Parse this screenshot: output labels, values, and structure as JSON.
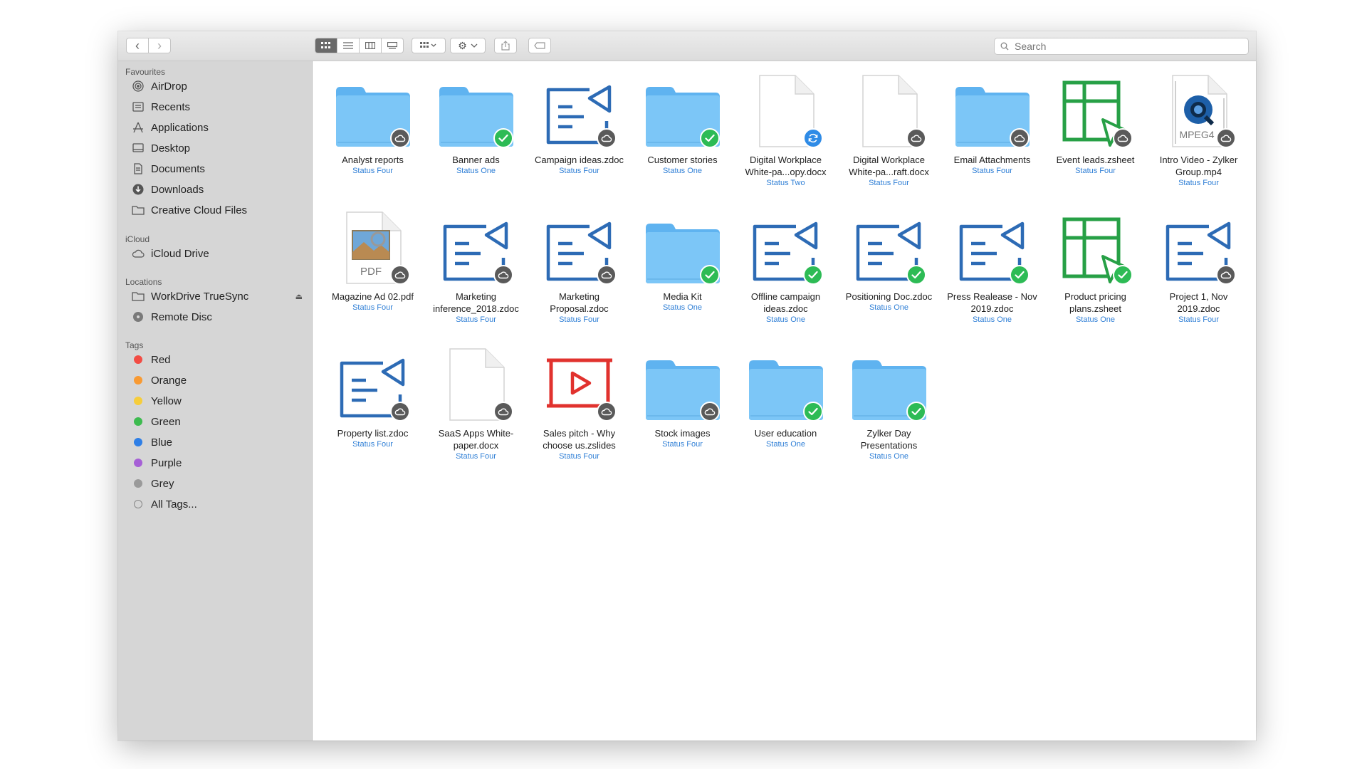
{
  "toolbar": {
    "back": "‹",
    "forward": "›",
    "search_placeholder": "Search"
  },
  "sidebar": {
    "favourites_title": "Favourites",
    "favourites": [
      {
        "label": "AirDrop",
        "icon": "airdrop-icon"
      },
      {
        "label": "Recents",
        "icon": "recents-icon"
      },
      {
        "label": "Applications",
        "icon": "applications-icon"
      },
      {
        "label": "Desktop",
        "icon": "desktop-icon"
      },
      {
        "label": "Documents",
        "icon": "documents-icon"
      },
      {
        "label": "Downloads",
        "icon": "downloads-icon"
      },
      {
        "label": "Creative Cloud Files",
        "icon": "folder-icon"
      }
    ],
    "icloud_title": "iCloud",
    "icloud": [
      {
        "label": "iCloud Drive",
        "icon": "cloud-icon"
      }
    ],
    "locations_title": "Locations",
    "locations": [
      {
        "label": "WorkDrive TrueSync",
        "icon": "drive-icon",
        "eject": "⏏"
      },
      {
        "label": "Remote Disc",
        "icon": "disc-icon"
      }
    ],
    "tags_title": "Tags",
    "tags": [
      {
        "label": "Red",
        "color": "#f24c44"
      },
      {
        "label": "Orange",
        "color": "#f89a32"
      },
      {
        "label": "Yellow",
        "color": "#f6cd3b"
      },
      {
        "label": "Green",
        "color": "#3dbb4f"
      },
      {
        "label": "Blue",
        "color": "#2f7fe6"
      },
      {
        "label": "Purple",
        "color": "#a660d6"
      },
      {
        "label": "Grey",
        "color": "#9a9a9a"
      },
      {
        "label": "All Tags...",
        "color": "#c4c4c4"
      }
    ]
  },
  "files": [
    {
      "name": "Analyst reports",
      "status": "Status Four",
      "kind": "folder",
      "badge": "cloud"
    },
    {
      "name": "Banner ads",
      "status": "Status One",
      "kind": "folder",
      "badge": "check"
    },
    {
      "name": "Campaign ideas.zdoc",
      "status": "Status Four",
      "kind": "zdoc",
      "badge": "cloud"
    },
    {
      "name": "Customer stories",
      "status": "Status One",
      "kind": "folder",
      "badge": "check"
    },
    {
      "name": "Digital Workplace White-pa...opy.docx",
      "status": "Status Two",
      "kind": "doc",
      "badge": "sync"
    },
    {
      "name": "Digital Workplace White-pa...raft.docx",
      "status": "Status Four",
      "kind": "doc",
      "badge": "cloud"
    },
    {
      "name": "Email Attachments",
      "status": "Status Four",
      "kind": "folder",
      "badge": "cloud"
    },
    {
      "name": "Event leads.zsheet",
      "status": "Status Four",
      "kind": "zsheet",
      "badge": "cloud"
    },
    {
      "name": "Intro Video - Zylker Group.mp4",
      "status": "Status Four",
      "kind": "video",
      "badge": "cloud",
      "label": "MPEG4"
    },
    {
      "name": "Magazine Ad 02.pdf",
      "status": "Status Four",
      "kind": "pdf",
      "badge": "cloud",
      "label": "PDF"
    },
    {
      "name": "Marketing inference_2018.zdoc",
      "status": "Status Four",
      "kind": "zdoc",
      "badge": "cloud"
    },
    {
      "name": "Marketing Proposal.zdoc",
      "status": "Status Four",
      "kind": "zdoc",
      "badge": "cloud"
    },
    {
      "name": "Media Kit",
      "status": "Status One",
      "kind": "folder",
      "badge": "check"
    },
    {
      "name": "Offline campaign ideas.zdoc",
      "status": "Status One",
      "kind": "zdoc",
      "badge": "check"
    },
    {
      "name": "Positioning Doc.zdoc",
      "status": "Status One",
      "kind": "zdoc",
      "badge": "check"
    },
    {
      "name": "Press Realease - Nov 2019.zdoc",
      "status": "Status One",
      "kind": "zdoc",
      "badge": "check"
    },
    {
      "name": "Product pricing plans.zsheet",
      "status": "Status One",
      "kind": "zsheet",
      "badge": "check"
    },
    {
      "name": "Project 1, Nov 2019.zdoc",
      "status": "Status Four",
      "kind": "zdoc",
      "badge": "cloud"
    },
    {
      "name": "Property list.zdoc",
      "status": "Status Four",
      "kind": "zdoc",
      "badge": "cloud"
    },
    {
      "name": "SaaS Apps White-paper.docx",
      "status": "Status Four",
      "kind": "doc",
      "badge": "cloud"
    },
    {
      "name": "Sales pitch - Why choose us.zslides",
      "status": "Status Four",
      "kind": "zslides",
      "badge": "cloud"
    },
    {
      "name": "Stock images",
      "status": "Status Four",
      "kind": "folder",
      "badge": "cloud"
    },
    {
      "name": "User education",
      "status": "Status One",
      "kind": "folder",
      "badge": "check"
    },
    {
      "name": "Zylker Day Presentations",
      "status": "Status One",
      "kind": "folder",
      "badge": "check"
    }
  ]
}
